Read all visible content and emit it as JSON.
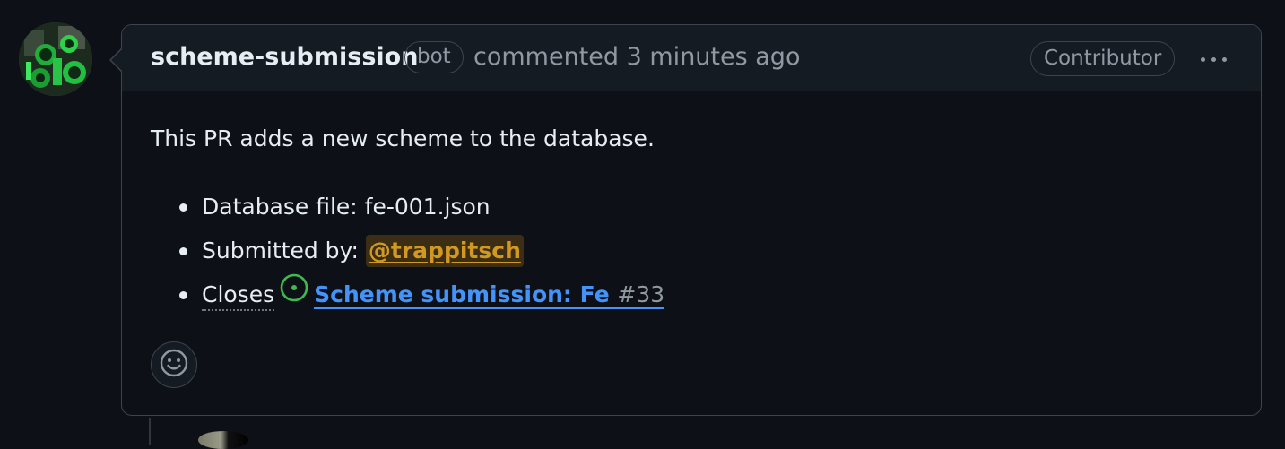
{
  "comment": {
    "author": "scheme-submission",
    "author_badge": "bot",
    "action": "commented",
    "timestamp": "3 minutes ago",
    "role_badge": "Contributor",
    "body": "This PR adds a new scheme to the database.",
    "details": {
      "database_file_label": "Database file: fe-001.json",
      "submitted_by_label": "Submitted by:",
      "submitted_by_user": "@trappitsch",
      "closes_label": "Closes",
      "closes_issue_title": "Scheme submission: Fe",
      "closes_issue_number": "#33"
    }
  },
  "icons": {
    "more_actions": "kebab-horizontal-icon",
    "issue_status": "issue-opened-icon",
    "reactions": "smiley-icon"
  },
  "colors": {
    "background": "#0d1117",
    "header": "#151b23",
    "border": "#3d444d",
    "link": "#4493f8",
    "mention": "#d29922",
    "issue_open": "#3fb950",
    "muted": "#9198a1"
  }
}
